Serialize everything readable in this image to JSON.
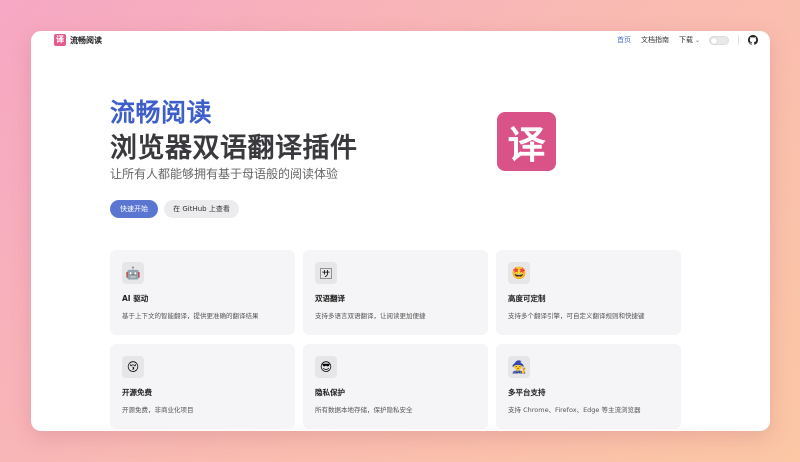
{
  "brand": {
    "logo_glyph": "译",
    "name": "流畅阅读"
  },
  "nav": {
    "links": [
      "首页",
      "文档指南",
      "下载"
    ],
    "download_chevron": "⌄",
    "active_color": "#4a6fd0",
    "github_icon": "github-icon"
  },
  "hero": {
    "title_line1": "流畅阅读",
    "title_line2": "浏览器双语翻译插件",
    "subtitle": "让所有人都能够拥有基于母语般的阅读体验",
    "primary_button": "快速开始",
    "secondary_button": "在 GitHub 上查看",
    "logo_glyph": "译",
    "logo_color": "#d95389"
  },
  "features": [
    {
      "icon": "robot-icon",
      "emoji": "🤖",
      "title": "AI 驱动",
      "desc": "基于上下文的智能翻译，提供更准确的翻译结果"
    },
    {
      "icon": "translate-icon",
      "emoji": "🈂",
      "title": "双语翻译",
      "desc": "支持多语言双语翻译，让阅读更加便捷"
    },
    {
      "icon": "star-struck-icon",
      "emoji": "🤩",
      "title": "高度可定制",
      "desc": "支持多个翻译引擎，可自定义翻译规则和快捷键"
    },
    {
      "icon": "kissing-face-icon",
      "emoji": "😚",
      "title": "开源免费",
      "desc": "开源免费，非商业化项目"
    },
    {
      "icon": "sunglasses-face-icon",
      "emoji": "😎",
      "title": "隐私保护",
      "desc": "所有数据本地存储，保护隐私安全"
    },
    {
      "icon": "mage-icon",
      "emoji": "🧙",
      "title": "多平台支持",
      "desc": "支持 Chrome、Firefox、Edge 等主流浏览器"
    }
  ]
}
